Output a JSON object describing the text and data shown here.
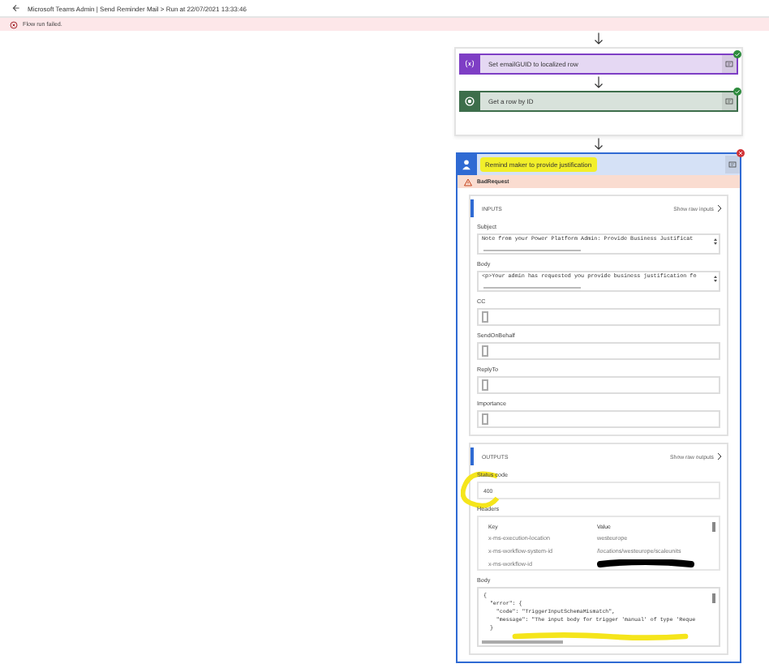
{
  "header": {
    "title": "Microsoft Teams Admin | Send Reminder Mail > Run at 22/07/2021 13:33:46"
  },
  "banner": {
    "kind": "error",
    "text": "Flow run failed."
  },
  "steps": [
    {
      "title": "Set emailGUID to localized row",
      "color": "#7e3ec5",
      "failed": false
    },
    {
      "title": "Get a row by ID",
      "color": "#3d6e4b",
      "failed": false
    }
  ],
  "failed_step": {
    "title": "Remind maker to provide justification",
    "color": "#2f6ad3",
    "failed": true,
    "highlighted": true,
    "error": "BadRequest",
    "inputs": {
      "heading": "INPUTS",
      "link": "Show raw inputs",
      "fields": [
        {
          "label": "Subject",
          "value": "Note from your Power Platform Admin: Provide Business Justificat"
        },
        {
          "label": "Body",
          "value": "<p>Your admin has requested you provide business justification fo"
        },
        {
          "label": "CC"
        },
        {
          "label": "SendOnBehalf"
        },
        {
          "label": "ReplyTo"
        },
        {
          "label": "Importance"
        }
      ]
    },
    "outputs": {
      "heading": "OUTPUTS",
      "link": "Show raw outputs",
      "status_label": "Status code",
      "status_value": "400",
      "status_marked": true,
      "headers": {
        "label": "Headers",
        "columns": [
          "Key",
          "Value"
        ],
        "rows": [
          {
            "key": "x-ms-execution-location",
            "value": "westeurope",
            "redacted": false
          },
          {
            "key": "x-ms-workflow-system-id",
            "value": "/locations/westeurope/scaleunits",
            "redacted": false
          },
          {
            "key": "x-ms-workflow-id",
            "redacted": true
          }
        ]
      },
      "body": {
        "label": "Body",
        "marked": true,
        "lines": [
          "{",
          "  \"error\": {",
          "    \"code\": \"TriggerInputSchemaMismatch\",",
          "    \"message\": \"The input body for trigger 'manual' of type 'Reque",
          "  }"
        ]
      }
    }
  }
}
